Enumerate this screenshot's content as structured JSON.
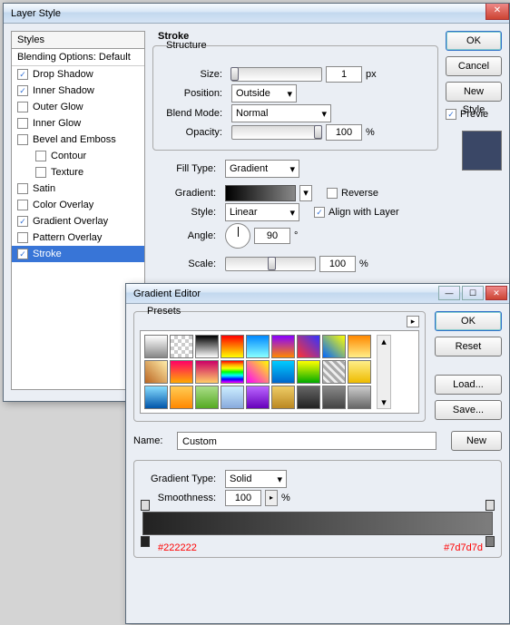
{
  "layerStyle": {
    "title": "Layer Style",
    "stylesHeader": "Styles",
    "blendingDefault": "Blending Options: Default",
    "items": [
      {
        "label": "Drop Shadow",
        "checked": true
      },
      {
        "label": "Inner Shadow",
        "checked": true
      },
      {
        "label": "Outer Glow",
        "checked": false
      },
      {
        "label": "Inner Glow",
        "checked": false
      },
      {
        "label": "Bevel and Emboss",
        "checked": false
      },
      {
        "label": "Contour",
        "checked": false,
        "indent": true
      },
      {
        "label": "Texture",
        "checked": false,
        "indent": true
      },
      {
        "label": "Satin",
        "checked": false
      },
      {
        "label": "Color Overlay",
        "checked": false
      },
      {
        "label": "Gradient Overlay",
        "checked": true
      },
      {
        "label": "Pattern Overlay",
        "checked": false
      },
      {
        "label": "Stroke",
        "checked": true,
        "selected": true
      }
    ],
    "stroke": {
      "groupLabel": "Stroke",
      "structureLabel": "Structure",
      "sizeLabel": "Size:",
      "size": "1",
      "px": "px",
      "positionLabel": "Position:",
      "position": "Outside",
      "blendLabel": "Blend Mode:",
      "blend": "Normal",
      "opacityLabel": "Opacity:",
      "opacity": "100",
      "pct": "%",
      "fillTypeLabel": "Fill Type:",
      "fillType": "Gradient",
      "gradientLabel": "Gradient:",
      "reverseLabel": "Reverse",
      "styleLabel": "Style:",
      "style": "Linear",
      "alignLabel": "Align with Layer",
      "angleLabel": "Angle:",
      "angle": "90",
      "deg": "°",
      "scaleLabel": "Scale:",
      "scale": "100"
    },
    "buttons": {
      "ok": "OK",
      "cancel": "Cancel",
      "newStyle": "New Style",
      "preview": "Previe"
    }
  },
  "gradEditor": {
    "title": "Gradient Editor",
    "presetsLabel": "Presets",
    "buttons": {
      "ok": "OK",
      "reset": "Reset",
      "load": "Load...",
      "save": "Save...",
      "new": "New"
    },
    "nameLabel": "Name:",
    "name": "Custom",
    "typeLabel": "Gradient Type:",
    "type": "Solid",
    "smoothLabel": "Smoothness:",
    "smooth": "100",
    "pct": "%",
    "leftHex": "#222222",
    "rightHex": "#7d7d7d",
    "swatches": [
      "linear-gradient(#fff,#888)",
      "repeating-conic-gradient(#ccc 0 25%,#fff 0 50%) 0/8px 8px",
      "linear-gradient(#000,#fff)",
      "linear-gradient(red,yellow)",
      "linear-gradient(#08f,#8ff)",
      "linear-gradient(#80f,#f80)",
      "linear-gradient(45deg,#f33,#33f)",
      "linear-gradient(45deg,#06f,#ff0)",
      "linear-gradient(#f80,#fe8)",
      "linear-gradient(45deg,#b62,#fea)",
      "linear-gradient(#f06,#fa0)",
      "linear-gradient(#c06,#fc6)",
      "linear-gradient(red,orange,yellow,lime,cyan,blue,magenta)",
      "linear-gradient(45deg,#f0f,#ff0)",
      "linear-gradient(#0cf,#06c)",
      "linear-gradient(#ff0,#0a0)",
      "repeating-linear-gradient(45deg,#aaa 0 3px,#eee 3px 6px)",
      "linear-gradient(#fe8,#eb0)",
      "linear-gradient(#8df,#05a)",
      "linear-gradient(#fc5,#f80)",
      "linear-gradient(#ad8,#5a2)",
      "linear-gradient(#cef,#8ad)",
      "linear-gradient(#b6f,#60b)",
      "linear-gradient(#ec6,#b82)",
      "linear-gradient(#666,#222)",
      "linear-gradient(#888,#444)",
      "linear-gradient(#ccc,#666)"
    ]
  }
}
